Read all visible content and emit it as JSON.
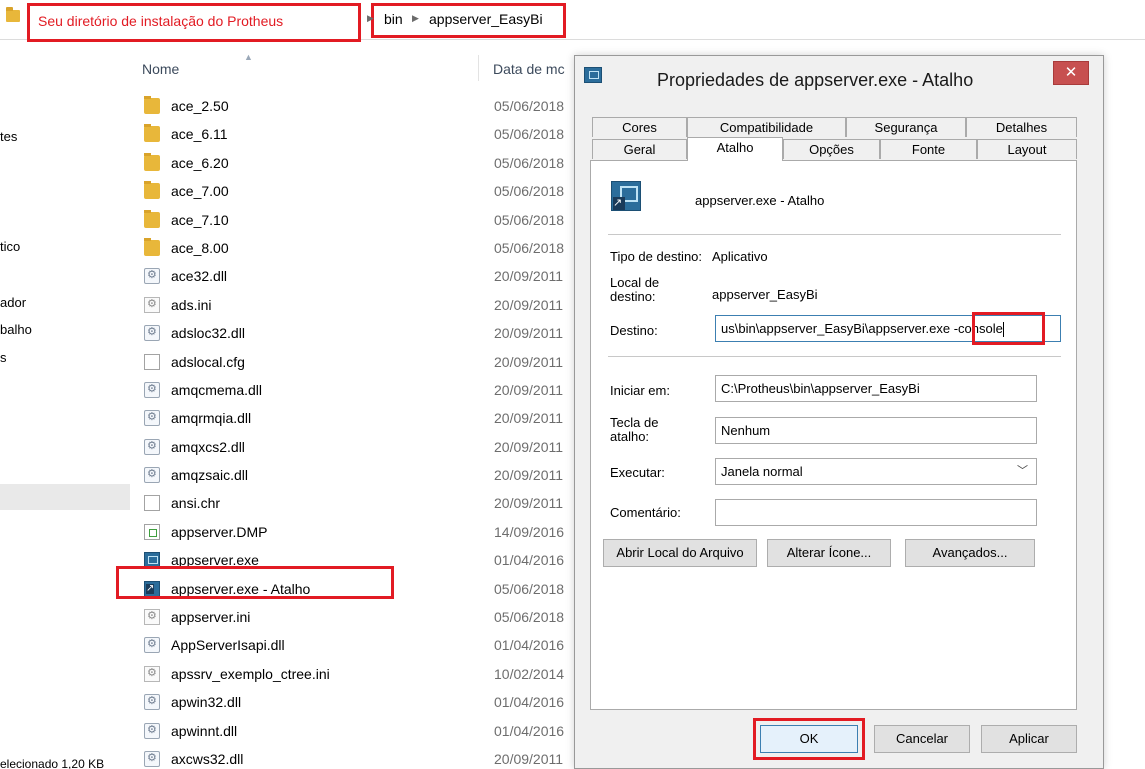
{
  "explorer": {
    "address": {
      "root_label": "Seu diretório de instalação do Protheus",
      "crumbs": [
        "bin",
        "appserver_EasyBi"
      ]
    },
    "columns": {
      "name": "Nome",
      "date": "Data de mc"
    },
    "nav_fragments": [
      "tes",
      "tico",
      "ador",
      "balho",
      "s"
    ],
    "status_text": "elecionado  1,20 KB",
    "files": [
      {
        "name": "ace_2.50",
        "date": "05/06/2018",
        "icon": "folder-icon"
      },
      {
        "name": "ace_6.11",
        "date": "05/06/2018",
        "icon": "folder-icon"
      },
      {
        "name": "ace_6.20",
        "date": "05/06/2018",
        "icon": "folder-icon"
      },
      {
        "name": "ace_7.00",
        "date": "05/06/2018",
        "icon": "folder-icon"
      },
      {
        "name": "ace_7.10",
        "date": "05/06/2018",
        "icon": "folder-icon"
      },
      {
        "name": "ace_8.00",
        "date": "05/06/2018",
        "icon": "folder-icon"
      },
      {
        "name": "ace32.dll",
        "date": "20/09/2011",
        "icon": "dll-icon"
      },
      {
        "name": "ads.ini",
        "date": "20/09/2011",
        "icon": "ini-icon"
      },
      {
        "name": "adsloc32.dll",
        "date": "20/09/2011",
        "icon": "dll-icon"
      },
      {
        "name": "adslocal.cfg",
        "date": "20/09/2011",
        "icon": "file-icon"
      },
      {
        "name": "amqcmema.dll",
        "date": "20/09/2011",
        "icon": "dll-icon"
      },
      {
        "name": "amqrmqia.dll",
        "date": "20/09/2011",
        "icon": "dll-icon"
      },
      {
        "name": "amqxcs2.dll",
        "date": "20/09/2011",
        "icon": "dll-icon"
      },
      {
        "name": "amqzsaic.dll",
        "date": "20/09/2011",
        "icon": "dll-icon"
      },
      {
        "name": "ansi.chr",
        "date": "20/09/2011",
        "icon": "file-icon"
      },
      {
        "name": "appserver.DMP",
        "date": "14/09/2016",
        "icon": "dmp-icon"
      },
      {
        "name": "appserver.exe",
        "date": "01/04/2016",
        "icon": "exe-icon"
      },
      {
        "name": "appserver.exe - Atalho",
        "date": "05/06/2018",
        "icon": "shortcut-icon"
      },
      {
        "name": "appserver.ini",
        "date": "05/06/2018",
        "icon": "ini-icon"
      },
      {
        "name": "AppServerIsapi.dll",
        "date": "01/04/2016",
        "icon": "dll-icon"
      },
      {
        "name": "apssrv_exemplo_ctree.ini",
        "date": "10/02/2014",
        "icon": "ini-icon"
      },
      {
        "name": "apwin32.dll",
        "date": "01/04/2016",
        "icon": "dll-icon"
      },
      {
        "name": "apwinnt.dll",
        "date": "01/04/2016",
        "icon": "dll-icon"
      },
      {
        "name": "axcws32.dll",
        "date": "20/09/2011",
        "icon": "dll-icon"
      }
    ]
  },
  "dialog": {
    "title": "Propriedades de appserver.exe - Atalho",
    "close_glyph": "✕",
    "tabs_back": [
      "Cores",
      "Compatibilidade",
      "Segurança",
      "Detalhes"
    ],
    "tabs_front": [
      "Geral",
      "Atalho",
      "Opções",
      "Fonte",
      "Layout"
    ],
    "active_tab": "Atalho",
    "shortcut_name": "appserver.exe - Atalho",
    "target_type_label": "Tipo de destino:",
    "target_type_value": "Aplicativo",
    "target_location_label_1": "Local de",
    "target_location_label_2": "destino:",
    "target_location_value": "appserver_EasyBi",
    "target_label": "Destino:",
    "target_value": "us\\bin\\appserver_EasyBi\\appserver.exe",
    "target_suffix": "-console",
    "start_in_label": "Iniciar em:",
    "start_in_value": "C:\\Protheus\\bin\\appserver_EasyBi",
    "shortcut_key_label_1": "Tecla de",
    "shortcut_key_label_2": "atalho:",
    "shortcut_key_value": "Nenhum",
    "run_label": "Executar:",
    "run_value": "Janela normal",
    "comment_label": "Comentário:",
    "comment_value": "",
    "buttons": {
      "open_location": "Abrir Local do Arquivo",
      "change_icon": "Alterar Ícone...",
      "advanced": "Avançados...",
      "ok": "OK",
      "cancel": "Cancelar",
      "apply": "Aplicar"
    }
  },
  "colors": {
    "highlight": "#e21b23",
    "accent": "#3c7fb1",
    "close_button": "#c75050"
  }
}
